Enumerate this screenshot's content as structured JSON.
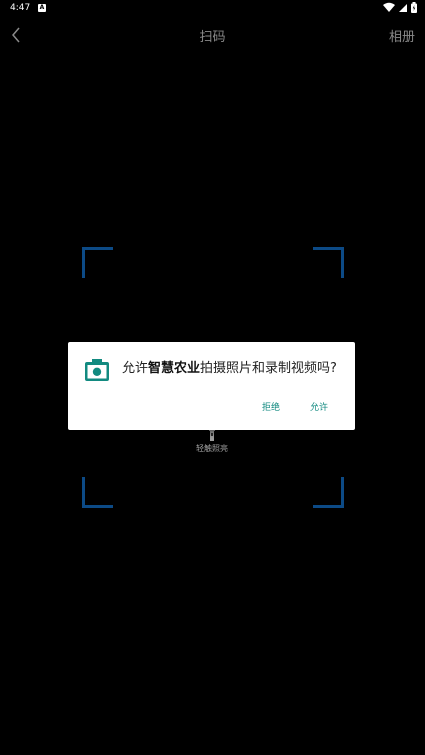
{
  "status_bar": {
    "time": "4:47",
    "notification_letter": "A"
  },
  "header": {
    "title": "扫码",
    "album_label": "相册"
  },
  "scanner": {
    "flash_label": "轻触照亮",
    "corner_color": "#0c4a86"
  },
  "dialog": {
    "message_prefix": "允许",
    "app_name": "智慧农业",
    "message_suffix": "拍摄照片和录制视频吗?",
    "deny_label": "拒绝",
    "allow_label": "允许",
    "accent_color": "#128a80",
    "icon": "camera-icon"
  }
}
